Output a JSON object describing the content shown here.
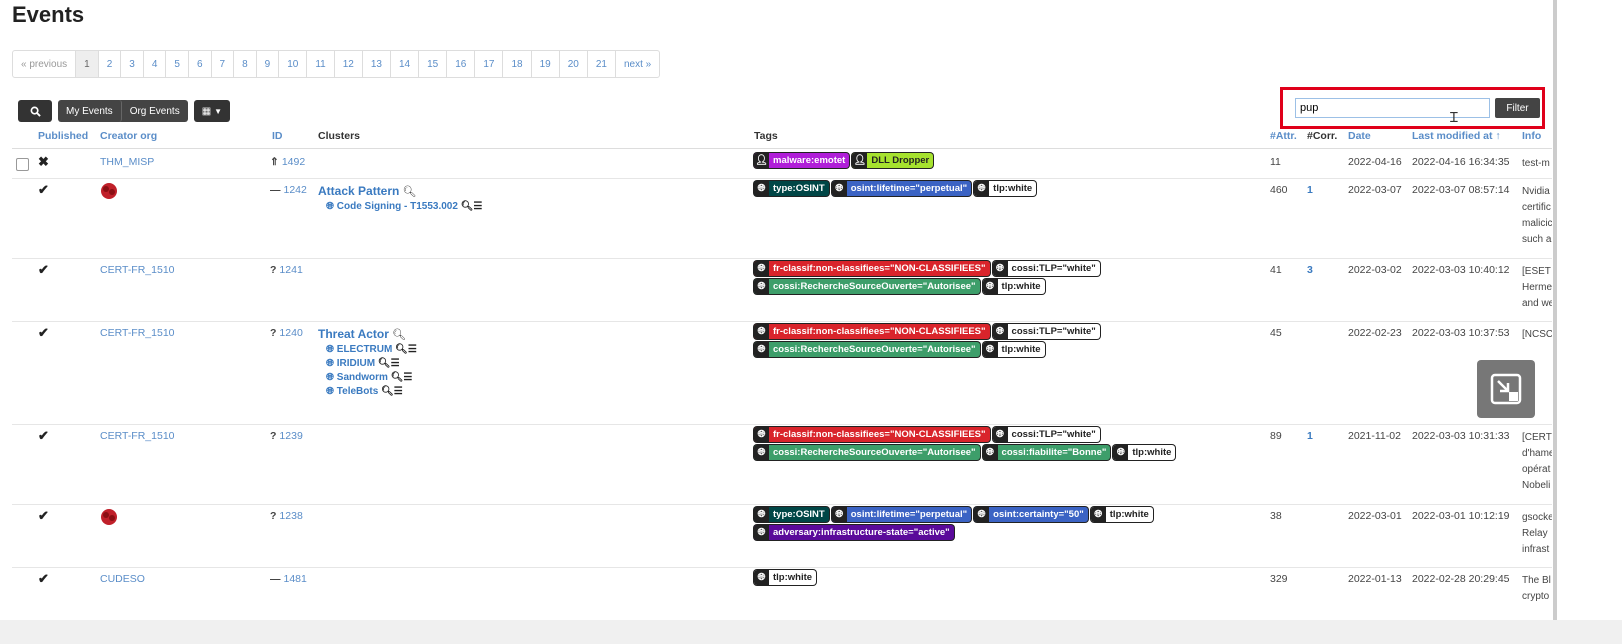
{
  "page": {
    "title": "Events"
  },
  "pagination": {
    "prev": "« previous",
    "pages": [
      "1",
      "2",
      "3",
      "4",
      "5",
      "6",
      "7",
      "8",
      "9",
      "10",
      "11",
      "12",
      "13",
      "14",
      "15",
      "16",
      "17",
      "18",
      "19",
      "20",
      "21"
    ],
    "next": "next »",
    "active": "1"
  },
  "toolbar": {
    "my_events": "My Events",
    "org_events": "Org Events"
  },
  "filter": {
    "value": "pup",
    "button": "Filter"
  },
  "columns": {
    "published": "Published",
    "creator_org": "Creator org",
    "id": "ID",
    "clusters": "Clusters",
    "tags": "Tags",
    "attr": "#Attr.",
    "corr": "#Corr.",
    "date": "Date",
    "last_modified": "Last modified at ↑",
    "info": "Info"
  },
  "rows": [
    {
      "published": "✖",
      "org": "THM_MISP",
      "id_prefix": "⇑",
      "id": "1492",
      "clusters": [],
      "tags": [
        {
          "label": "malware:emotet",
          "color": "#b01ed8",
          "icon": "user"
        },
        {
          "label": "DLL Dropper",
          "color": "#a6e22e",
          "icon": "user",
          "dark_text": true
        }
      ],
      "attr": "11",
      "corr": "",
      "date": "2022-04-16",
      "modified": "2022-04-16 16:34:35",
      "info": [
        "test-m"
      ]
    },
    {
      "published": "✔",
      "org": "",
      "logo": true,
      "id_prefix": "—",
      "id": "1242",
      "clusters": [
        {
          "title": "Attack Pattern",
          "items": [
            "Code Signing - T1553.002"
          ]
        }
      ],
      "tags": [
        {
          "label": "type:OSINT",
          "color": "#004646",
          "icon": "globe"
        },
        {
          "label": "osint:lifetime=\"perpetual\"",
          "color": "#3b63c4",
          "icon": "globe"
        },
        {
          "label": "tlp:white",
          "color": "#ffffff",
          "icon": "globe",
          "dark_text": true
        }
      ],
      "attr": "460",
      "corr": "1",
      "date": "2022-03-07",
      "modified": "2022-03-07 08:57:14",
      "info": [
        "Nvidia",
        "certific",
        "malicic",
        "such a"
      ]
    },
    {
      "published": "✔",
      "org": "CERT-FR_1510",
      "id_prefix": "?",
      "id": "1241",
      "clusters": [],
      "tags": [
        {
          "label": "fr-classif:non-classifiees=\"NON-CLASSIFIEES\"",
          "color": "#d9242b",
          "icon": "globe"
        },
        {
          "label": "cossi:TLP=\"white\"",
          "color": "#ffffff",
          "icon": "globe",
          "dark_text": true
        },
        {
          "label": "cossi:RechercheSourceOuverte=\"Autorisee\"",
          "color": "#3d9e6a",
          "icon": "globe"
        },
        {
          "label": "tlp:white",
          "color": "#ffffff",
          "icon": "globe",
          "dark_text": true
        }
      ],
      "attr": "41",
      "corr": "3",
      "date": "2022-03-02",
      "modified": "2022-03-03 10:40:12",
      "info": [
        "[ESET",
        "Herme",
        "and we"
      ]
    },
    {
      "published": "✔",
      "org": "CERT-FR_1510",
      "id_prefix": "?",
      "id": "1240",
      "clusters": [
        {
          "title": "Threat Actor",
          "items": [
            "ELECTRUM",
            "IRIDIUM",
            "Sandworm",
            "TeleBots"
          ]
        }
      ],
      "tags": [
        {
          "label": "fr-classif:non-classifiees=\"NON-CLASSIFIEES\"",
          "color": "#d9242b",
          "icon": "globe"
        },
        {
          "label": "cossi:TLP=\"white\"",
          "color": "#ffffff",
          "icon": "globe",
          "dark_text": true
        },
        {
          "label": "cossi:RechercheSourceOuverte=\"Autorisee\"",
          "color": "#3d9e6a",
          "icon": "globe"
        },
        {
          "label": "tlp:white",
          "color": "#ffffff",
          "icon": "globe",
          "dark_text": true
        }
      ],
      "attr": "45",
      "corr": "",
      "date": "2022-02-23",
      "modified": "2022-03-03 10:37:53",
      "info": [
        "[NCSC"
      ]
    },
    {
      "published": "✔",
      "org": "CERT-FR_1510",
      "id_prefix": "?",
      "id": "1239",
      "clusters": [],
      "tags": [
        {
          "label": "fr-classif:non-classifiees=\"NON-CLASSIFIEES\"",
          "color": "#d9242b",
          "icon": "globe"
        },
        {
          "label": "cossi:TLP=\"white\"",
          "color": "#ffffff",
          "icon": "globe",
          "dark_text": true
        },
        {
          "label": "cossi:RechercheSourceOuverte=\"Autorisee\"",
          "color": "#3d9e6a",
          "icon": "globe"
        },
        {
          "label": "cossi:fiabilite=\"Bonne\"",
          "color": "#3d9e6a",
          "icon": "globe"
        },
        {
          "label": "tlp:white",
          "color": "#ffffff",
          "icon": "globe",
          "dark_text": true
        }
      ],
      "attr": "89",
      "corr": "1",
      "date": "2021-11-02",
      "modified": "2022-03-03 10:31:33",
      "info": [
        "[CERT",
        "d'hame",
        "opérat",
        "Nobeli"
      ]
    },
    {
      "published": "✔",
      "org": "",
      "logo": true,
      "id_prefix": "?",
      "id": "1238",
      "clusters": [],
      "tags": [
        {
          "label": "type:OSINT",
          "color": "#004646",
          "icon": "globe"
        },
        {
          "label": "osint:lifetime=\"perpetual\"",
          "color": "#3b63c4",
          "icon": "globe"
        },
        {
          "label": "osint:certainty=\"50\"",
          "color": "#3b63c4",
          "icon": "globe"
        },
        {
          "label": "tlp:white",
          "color": "#ffffff",
          "icon": "globe",
          "dark_text": true
        },
        {
          "label": "adversary:infrastructure-state=\"active\"",
          "color": "#5a0a9a",
          "icon": "globe"
        }
      ],
      "attr": "38",
      "corr": "",
      "date": "2022-03-01",
      "modified": "2022-03-01 10:12:19",
      "info": [
        "gsocke",
        "Relay",
        "infrast"
      ]
    },
    {
      "published": "✔",
      "org": "CUDESO",
      "id_prefix": "—",
      "id": "1481",
      "clusters": [],
      "tags": [
        {
          "label": "tlp:white",
          "color": "#ffffff",
          "icon": "globe",
          "dark_text": true
        }
      ],
      "attr": "329",
      "corr": "",
      "date": "2022-01-13",
      "modified": "2022-02-28 20:29:45",
      "info": [
        "The Bl",
        "crypto"
      ]
    }
  ],
  "colors": {
    "link": "#5a8dc8",
    "highlight_border": "#e0001a"
  }
}
